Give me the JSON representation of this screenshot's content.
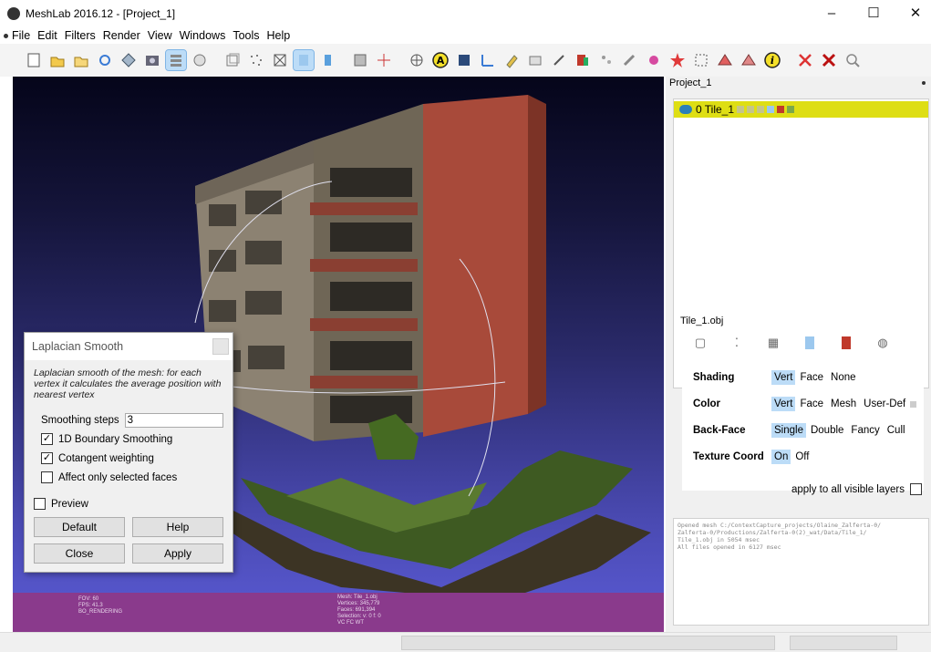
{
  "window": {
    "title": "MeshLab 2016.12 - [Project_1]",
    "minimize_glyph": "–",
    "maximize_glyph": "☐",
    "close_glyph": "✕"
  },
  "menu": [
    "File",
    "Edit",
    "Filters",
    "Render",
    "View",
    "Windows",
    "Tools",
    "Help"
  ],
  "toolbar_icons": [
    "new-project-icon",
    "open-project-icon",
    "open-folder-icon",
    "reload-icon",
    "import-mesh-icon",
    "snapshot-icon",
    "layer-stack-icon",
    "globe-icon",
    "bounding-box-icon",
    "points-icon",
    "wireframe-icon",
    "flat-shading-icon",
    "smooth-shading-icon",
    "texture-icon",
    "axes-icon",
    "align-icon",
    "annotation-icon",
    "measure-icon",
    "paint-icon",
    "camera-icon",
    "pick-icon",
    "select-icon",
    "georef-icon",
    "star-icon",
    "info-icon",
    "delete-faces-icon",
    "delete-vertices-icon",
    "zoom-icon"
  ],
  "viewport": {
    "info_left": [
      "FOV: 60",
      "FPS:  41.3",
      "BO_RENDERING"
    ],
    "info_mid": [
      "Mesh: Tile_1.obj",
      "Vertices: 345,779",
      "Faces: 691,394",
      "Selection: v: 0 f: 0",
      "VC FC WT"
    ]
  },
  "dialog": {
    "title": "Laplacian Smooth",
    "description": "Laplacian smooth of the mesh: for each vertex it calculates the average position with nearest vertex",
    "smoothing_label": "Smoothing steps",
    "smoothing_value": "3",
    "opt_boundary": "1D Boundary Smoothing",
    "opt_cotangent": "Cotangent weighting",
    "opt_selected": "Affect only selected faces",
    "preview": "Preview",
    "btn_default": "Default",
    "btn_help": "Help",
    "btn_close": "Close",
    "btn_apply": "Apply",
    "checked_mark": "✓"
  },
  "right_panel": {
    "project": "Project_1",
    "layer_name": "0 Tile_1",
    "object_name": "Tile_1.obj",
    "shading_label": "Shading",
    "shading": [
      "Vert",
      "Face",
      "None"
    ],
    "color_label": "Color",
    "color": [
      "Vert",
      "Face",
      "Mesh",
      "User-Def"
    ],
    "backface_label": "Back-Face",
    "backface": [
      "Single",
      "Double",
      "Fancy",
      "Cull"
    ],
    "texcoord_label": "Texture Coord",
    "texcoord": [
      "On",
      "Off"
    ],
    "apply_all": "apply to all visible layers",
    "log_lines": [
      "Opened mesh C:/ContextCapture_projects/Olaine_Zalferta-0/",
      "Zalferta-0/Productions/Zalferta-0(2)_wat/Data/Tile_1/",
      "Tile_1.obj in 5054 msec",
      "All files opened in 6127 msec"
    ]
  },
  "colors": {
    "selected_layer": "#dede14",
    "info_bar": "#8a3a8c",
    "selection": "#bcdcf7"
  }
}
